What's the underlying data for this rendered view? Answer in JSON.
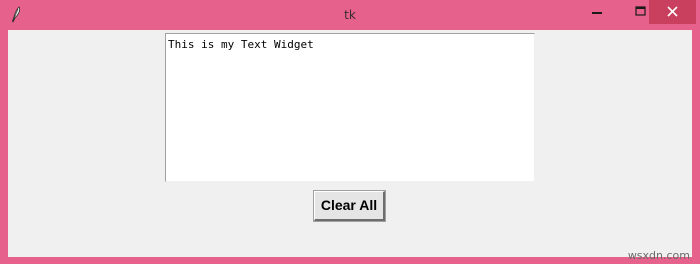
{
  "window": {
    "title": "tk",
    "app_icon": "feather-icon",
    "title_bar_color": "#e6628c",
    "close_hover_color": "#c8405d",
    "client_bg": "#f0f0f0"
  },
  "controls": {
    "minimize_icon": "minimize-icon",
    "maximize_icon": "maximize-icon",
    "close_icon": "close-icon"
  },
  "text_widget": {
    "content": "This is my Text Widget"
  },
  "button": {
    "label": "Clear All"
  },
  "watermark": {
    "text": "wsxdn.com"
  }
}
